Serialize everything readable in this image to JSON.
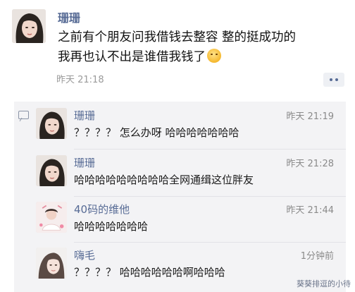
{
  "post": {
    "author": "珊珊",
    "text_line1": "之前有个朋友问我借钱去整容 整的挺成功的",
    "text_line2": "我再也认不出是谁借我钱了",
    "time": "昨天 21:18"
  },
  "comments": [
    {
      "name": "珊珊",
      "time": "昨天 21:19",
      "text": "？？？？ 怎么办呀 哈哈哈哈哈哈哈"
    },
    {
      "name": "珊珊",
      "time": "昨天 21:28",
      "text": "哈哈哈哈哈哈哈哈哈全网通缉这位胖友"
    },
    {
      "name": "40码的维他",
      "time": "昨天 21:44",
      "text": "哈哈哈哈哈哈哈"
    },
    {
      "name": "嗨毛",
      "time": "1分钟前",
      "text": "？？？？ 哈哈哈哈哈哈啊哈哈哈"
    }
  ],
  "watermark": "葵葵排逗的小待",
  "colors": {
    "name_link": "#576b95",
    "comment_bg": "#f3f3f5"
  }
}
